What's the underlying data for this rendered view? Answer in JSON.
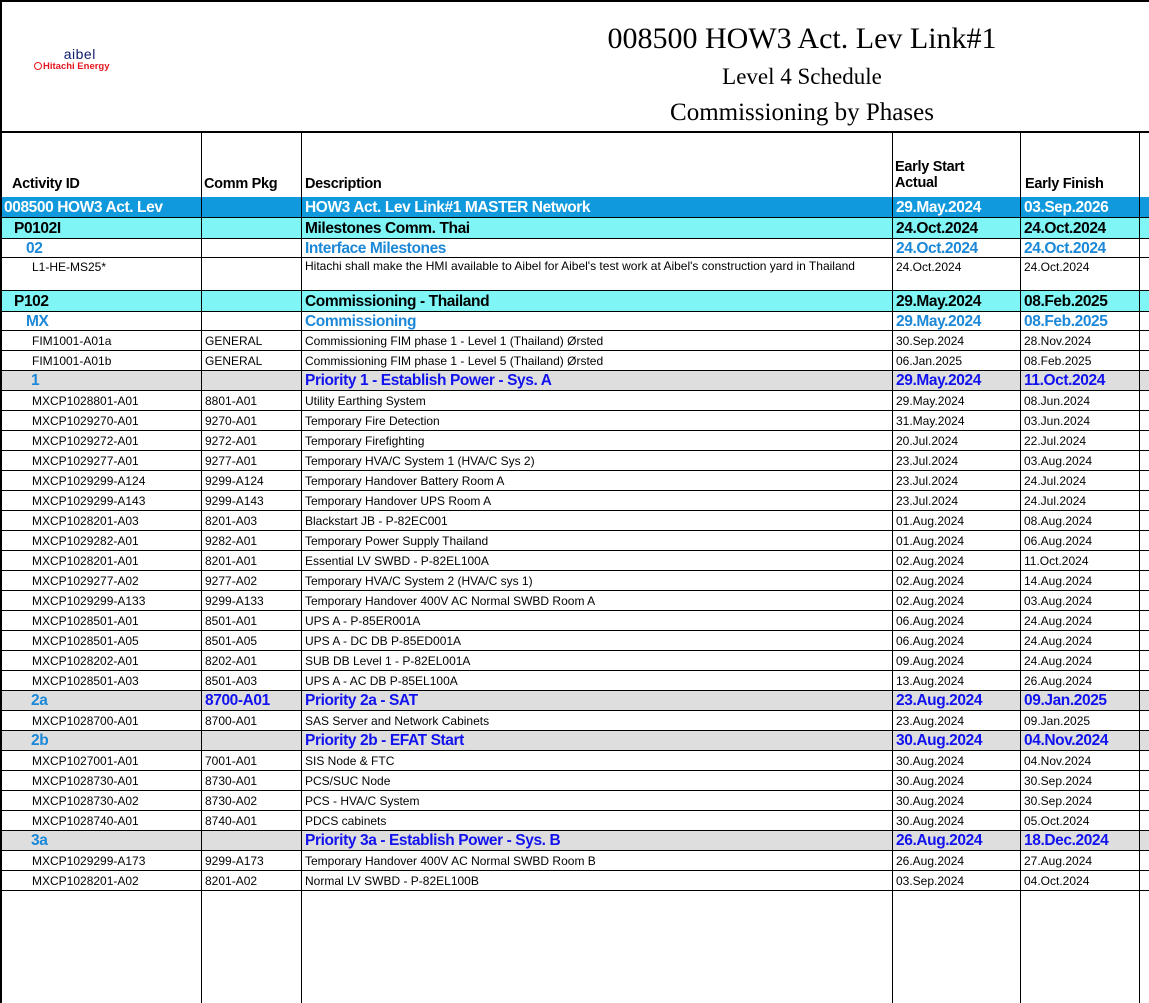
{
  "logo": {
    "name": "aibel",
    "tagline": "Hitachi Energy"
  },
  "titles": [
    "008500 HOW3 Act. Lev Link#1",
    "Level 4 Schedule",
    "Commissioning by Phases"
  ],
  "columns": {
    "activity_id": "Activity ID",
    "comm_pkg": "Comm Pkg",
    "description": "Description",
    "early_start_1": "Early Start",
    "early_start_2": "Actual",
    "early_finish": "Early Finish"
  },
  "rows": [
    {
      "level": "lvl0",
      "id": "008500 HOW3 Act. Lev",
      "pkg": "",
      "desc": "HOW3 Act. Lev Link#1 MASTER Network",
      "start": "29.May.2024",
      "finish": "03.Sep.2026"
    },
    {
      "level": "lvl1",
      "id": "P0102I",
      "pkg": "",
      "desc": "Milestones Comm. Thai",
      "start": "24.Oct.2024",
      "finish": "24.Oct.2024"
    },
    {
      "level": "lvl2",
      "id": "02",
      "pkg": "",
      "desc": "Interface Milestones",
      "start": "24.Oct.2024",
      "finish": "24.Oct.2024"
    },
    {
      "level": "act",
      "id": "L1-HE-MS25*",
      "pkg": "",
      "desc": "Hitachi shall make the HMI available to Aibel for Aibel's test work at Aibel's construction yard in Thailand",
      "start": "24.Oct.2024",
      "finish": "24.Oct.2024",
      "tall": true
    },
    {
      "level": "lvl1",
      "id": "P102",
      "pkg": "",
      "desc": "Commissioning - Thailand",
      "start": "29.May.2024",
      "finish": "08.Feb.2025"
    },
    {
      "level": "lvl2",
      "id": "MX",
      "pkg": "",
      "desc": "Commissioning",
      "start": "29.May.2024",
      "finish": "08.Feb.2025"
    },
    {
      "level": "act",
      "id": "FIM1001-A01a",
      "pkg": "GENERAL",
      "desc": "Commissioning FIM phase 1 - Level 1 (Thailand) Ørsted",
      "start": "30.Sep.2024",
      "finish": "28.Nov.2024"
    },
    {
      "level": "act",
      "id": "FIM1001-A01b",
      "pkg": "GENERAL",
      "desc": "Commissioning FIM phase 1 - Level 5 (Thailand) Ørsted",
      "start": "06.Jan.2025",
      "finish": "08.Feb.2025"
    },
    {
      "level": "prio",
      "id": "1",
      "pkg": "",
      "desc": "Priority 1 - Establish Power - Sys. A",
      "start": "29.May.2024",
      "finish": "11.Oct.2024"
    },
    {
      "level": "act",
      "id": "MXCP1028801-A01",
      "pkg": "8801-A01",
      "desc": "Utility Earthing System",
      "start": "29.May.2024",
      "finish": "08.Jun.2024"
    },
    {
      "level": "act",
      "id": "MXCP1029270-A01",
      "pkg": "9270-A01",
      "desc": "Temporary Fire Detection",
      "start": "31.May.2024",
      "finish": "03.Jun.2024"
    },
    {
      "level": "act",
      "id": "MXCP1029272-A01",
      "pkg": "9272-A01",
      "desc": "Temporary Firefighting",
      "start": "20.Jul.2024",
      "finish": "22.Jul.2024"
    },
    {
      "level": "act",
      "id": "MXCP1029277-A01",
      "pkg": "9277-A01",
      "desc": "Temporary HVA/C System 1 (HVA/C Sys 2)",
      "start": "23.Jul.2024",
      "finish": "03.Aug.2024"
    },
    {
      "level": "act",
      "id": "MXCP1029299-A124",
      "pkg": "9299-A124",
      "desc": "Temporary Handover Battery Room A",
      "start": "23.Jul.2024",
      "finish": "24.Jul.2024"
    },
    {
      "level": "act",
      "id": "MXCP1029299-A143",
      "pkg": "9299-A143",
      "desc": "Temporary Handover UPS Room A",
      "start": "23.Jul.2024",
      "finish": "24.Jul.2024"
    },
    {
      "level": "act",
      "id": "MXCP1028201-A03",
      "pkg": "8201-A03",
      "desc": "Blackstart JB - P-82EC001",
      "start": "01.Aug.2024",
      "finish": "08.Aug.2024"
    },
    {
      "level": "act",
      "id": "MXCP1029282-A01",
      "pkg": "9282-A01",
      "desc": "Temporary Power Supply Thailand",
      "start": "01.Aug.2024",
      "finish": "06.Aug.2024"
    },
    {
      "level": "act",
      "id": "MXCP1028201-A01",
      "pkg": "8201-A01",
      "desc": "Essential LV SWBD - P-82EL100A",
      "start": "02.Aug.2024",
      "finish": "11.Oct.2024"
    },
    {
      "level": "act",
      "id": "MXCP1029277-A02",
      "pkg": "9277-A02",
      "desc": "Temporary HVA/C System 2 (HVA/C sys 1)",
      "start": "02.Aug.2024",
      "finish": "14.Aug.2024"
    },
    {
      "level": "act",
      "id": "MXCP1029299-A133",
      "pkg": "9299-A133",
      "desc": "Temporary Handover 400V AC Normal SWBD Room A",
      "start": "02.Aug.2024",
      "finish": "03.Aug.2024"
    },
    {
      "level": "act",
      "id": "MXCP1028501-A01",
      "pkg": "8501-A01",
      "desc": "UPS A - P-85ER001A",
      "start": "06.Aug.2024",
      "finish": "24.Aug.2024"
    },
    {
      "level": "act",
      "id": "MXCP1028501-A05",
      "pkg": "8501-A05",
      "desc": "UPS A - DC DB P-85ED001A",
      "start": "06.Aug.2024",
      "finish": "24.Aug.2024"
    },
    {
      "level": "act",
      "id": "MXCP1028202-A01",
      "pkg": "8202-A01",
      "desc": "SUB DB Level 1 - P-82EL001A",
      "start": "09.Aug.2024",
      "finish": "24.Aug.2024"
    },
    {
      "level": "act",
      "id": "MXCP1028501-A03",
      "pkg": "8501-A03",
      "desc": "UPS A - AC DB P-85EL100A",
      "start": "13.Aug.2024",
      "finish": "26.Aug.2024"
    },
    {
      "level": "prio",
      "id": "2a",
      "pkg": "8700-A01",
      "desc": "Priority 2a -  SAT",
      "start": "23.Aug.2024",
      "finish": "09.Jan.2025"
    },
    {
      "level": "act",
      "id": "MXCP1028700-A01",
      "pkg": "8700-A01",
      "desc": "SAS Server and Network Cabinets",
      "start": "23.Aug.2024",
      "finish": "09.Jan.2025"
    },
    {
      "level": "prio",
      "id": "2b",
      "pkg": "",
      "desc": "Priority 2b - EFAT Start",
      "start": "30.Aug.2024",
      "finish": "04.Nov.2024"
    },
    {
      "level": "act",
      "id": "MXCP1027001-A01",
      "pkg": "7001-A01",
      "desc": "SIS Node & FTC",
      "start": "30.Aug.2024",
      "finish": "04.Nov.2024"
    },
    {
      "level": "act",
      "id": "MXCP1028730-A01",
      "pkg": "8730-A01",
      "desc": "PCS/SUC Node",
      "start": "30.Aug.2024",
      "finish": "30.Sep.2024"
    },
    {
      "level": "act",
      "id": "MXCP1028730-A02",
      "pkg": "8730-A02",
      "desc": "PCS - HVA/C System",
      "start": "30.Aug.2024",
      "finish": "30.Sep.2024"
    },
    {
      "level": "act",
      "id": "MXCP1028740-A01",
      "pkg": "8740-A01",
      "desc": "PDCS cabinets",
      "start": "30.Aug.2024",
      "finish": "05.Oct.2024"
    },
    {
      "level": "prio",
      "id": "3a",
      "pkg": "",
      "desc": "Priority 3a - Establish Power - Sys. B",
      "start": "26.Aug.2024",
      "finish": "18.Dec.2024"
    },
    {
      "level": "act",
      "id": "MXCP1029299-A173",
      "pkg": "9299-A173",
      "desc": "Temporary Handover 400V AC Normal SWBD Room B",
      "start": "26.Aug.2024",
      "finish": "27.Aug.2024"
    },
    {
      "level": "act",
      "id": "MXCP1028201-A02",
      "pkg": "8201-A02",
      "desc": "Normal LV SWBD - P-82EL100B",
      "start": "03.Sep.2024",
      "finish": "04.Oct.2024"
    }
  ]
}
